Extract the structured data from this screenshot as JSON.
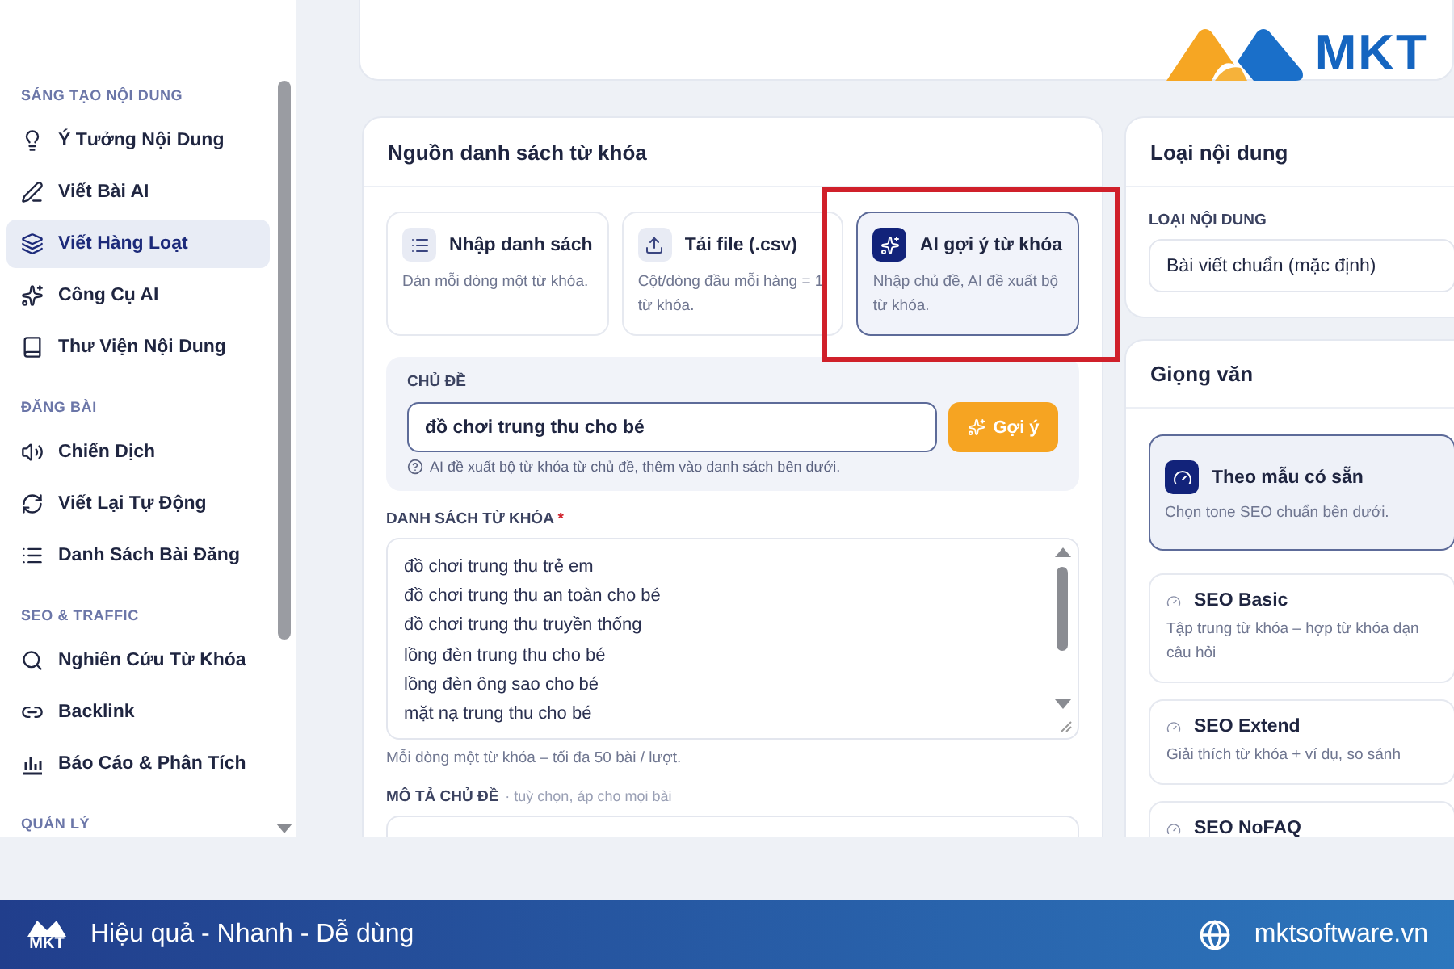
{
  "brand": {
    "logo_text": "MKT"
  },
  "sidebar": {
    "sections": [
      {
        "title": "SÁNG TẠO NỘI DUNG",
        "items": [
          {
            "label": "Ý Tưởng Nội Dung",
            "selected": false
          },
          {
            "label": "Viết Bài AI",
            "selected": false
          },
          {
            "label": "Viết Hàng Loạt",
            "selected": true
          },
          {
            "label": "Công Cụ AI",
            "selected": false
          },
          {
            "label": "Thư Viện Nội Dung",
            "selected": false
          }
        ]
      },
      {
        "title": "ĐĂNG BÀI",
        "items": [
          {
            "label": "Chiến Dịch",
            "selected": false
          },
          {
            "label": "Viết Lại Tự Động",
            "selected": false
          },
          {
            "label": "Danh Sách Bài Đăng",
            "selected": false
          }
        ]
      },
      {
        "title": "SEO & TRAFFIC",
        "items": [
          {
            "label": "Nghiên Cứu Từ Khóa",
            "selected": false
          },
          {
            "label": "Backlink",
            "selected": false
          },
          {
            "label": "Báo Cáo & Phân Tích",
            "selected": false
          }
        ]
      },
      {
        "title": "QUẢN LÝ"
      }
    ]
  },
  "source_card": {
    "title": "Nguồn danh sách từ khóa",
    "options": [
      {
        "title": "Nhập danh sách",
        "description": "Dán mỗi dòng một từ khóa.",
        "selected": false,
        "highlighted": false
      },
      {
        "title": "Tải file (.csv)",
        "description": "Cột/dòng đầu mỗi hàng = 1 từ khóa.",
        "selected": false,
        "highlighted": false
      },
      {
        "title": "AI gợi ý từ khóa",
        "description": "Nhập chủ đề, AI đề xuất bộ từ khóa.",
        "selected": true,
        "highlighted": true
      }
    ],
    "topic": {
      "label": "CHỦ ĐỀ",
      "value": "đồ chơi trung thu cho bé",
      "button": "Gợi ý",
      "hint": "AI đề xuất bộ từ khóa từ chủ đề, thêm vào danh sách bên dưới."
    },
    "keywords": {
      "label": "DANH SÁCH TỪ KHÓA",
      "required": true,
      "required_mark": "*",
      "lines": [
        "đồ chơi trung thu trẻ em",
        "đồ chơi trung thu an toàn cho bé",
        "đồ chơi trung thu truyền thống",
        "lồng đèn trung thu cho bé",
        "lồng đèn ông sao cho bé",
        "mặt nạ trung thu cho bé"
      ],
      "hint": "Mỗi dòng một từ khóa – tối đa 50 bài / lượt."
    },
    "description": {
      "label": "MÔ TẢ CHỦ ĐỀ",
      "note": "· tuỳ chọn, áp cho mọi bài"
    }
  },
  "content_type_card": {
    "title": "Loại nội dung",
    "field_label": "LOẠI NỘI DUNG",
    "value": "Bài viết chuẩn (mặc định)"
  },
  "tone_card": {
    "title": "Giọng văn",
    "options": [
      {
        "title": "Theo mẫu có sẵn",
        "description": "Chọn tone SEO chuẩn bên dưới.",
        "selected": true
      },
      {
        "title": "SEO Basic",
        "description": "Tập trung từ khóa – hợp từ khóa dạn câu hỏi",
        "selected": false
      },
      {
        "title": "SEO Extend",
        "description": "Giải thích từ khóa + ví dụ, so sánh",
        "selected": false
      },
      {
        "title": "SEO NoFAQ",
        "selected": false
      }
    ]
  },
  "footer": {
    "logo_text": "MKT",
    "tagline": "Hiệu quả - Nhanh - Dễ dùng",
    "website": "mktsoftware.vn"
  }
}
